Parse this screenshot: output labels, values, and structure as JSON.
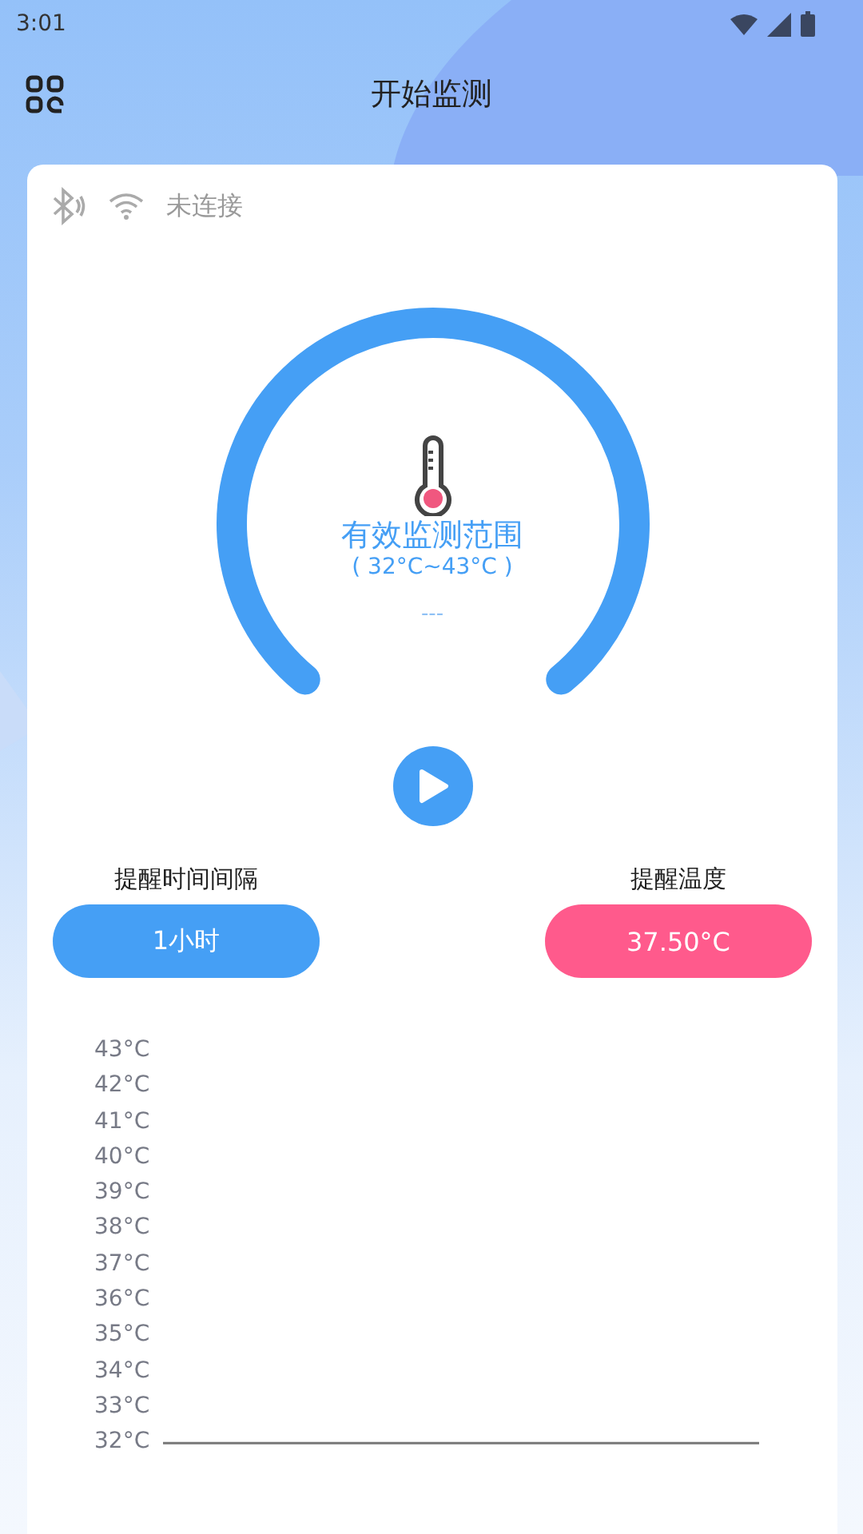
{
  "status_bar": {
    "time": "3:01"
  },
  "header": {
    "title": "开始监测"
  },
  "connection": {
    "status": "未连接"
  },
  "gauge": {
    "title": "有效监测范围",
    "range": "( 32°C~43°C )",
    "reading": "---"
  },
  "settings": [
    {
      "label": "提醒时间间隔",
      "value": "1小时",
      "color": "#459ff5"
    },
    {
      "label": "提醒温度",
      "value": "37.50°C",
      "color": "#ff5a8c"
    }
  ],
  "chart": {
    "y_labels": [
      "43°C",
      "42°C",
      "41°C",
      "40°C",
      "39°C",
      "38°C",
      "37°C",
      "36°C",
      "35°C",
      "34°C",
      "33°C",
      "32°C"
    ]
  }
}
